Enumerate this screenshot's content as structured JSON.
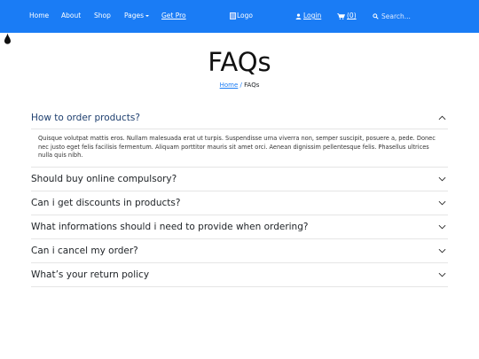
{
  "nav": {
    "links": [
      "Home",
      "About",
      "Shop",
      "Pages",
      "Get Pro"
    ],
    "logo_alt": "Logo",
    "login_label": "Login",
    "cart_count": "(0)",
    "search_placeholder": "Search..."
  },
  "colors": {
    "navbar": "#1a7cf5",
    "question_active": "#1e3f6f"
  },
  "page": {
    "title": "FAQs",
    "breadcrumb": {
      "home": "Home",
      "separator": "/",
      "current": "FAQs"
    }
  },
  "faq": {
    "items": [
      {
        "question": "How to order products?",
        "answer": "Quisque volutpat mattis eros. Nullam malesuada erat ut turpis. Suspendisse urna viverra non, semper suscipit, posuere a, pede. Donec nec justo eget felis facilisis fermentum. Aliquam porttitor mauris sit amet orci. Aenean dignissim pellentesque felis. Phasellus ultrices nulla quis nibh.",
        "expanded": true
      },
      {
        "question": "Should buy online compulsory?",
        "expanded": false
      },
      {
        "question": "Can i get discounts in products?",
        "expanded": false
      },
      {
        "question": "What informations should i need to provide when ordering?",
        "expanded": false
      },
      {
        "question": "Can i cancel my order?",
        "expanded": false
      },
      {
        "question": "What’s your return policy",
        "expanded": false
      }
    ]
  }
}
